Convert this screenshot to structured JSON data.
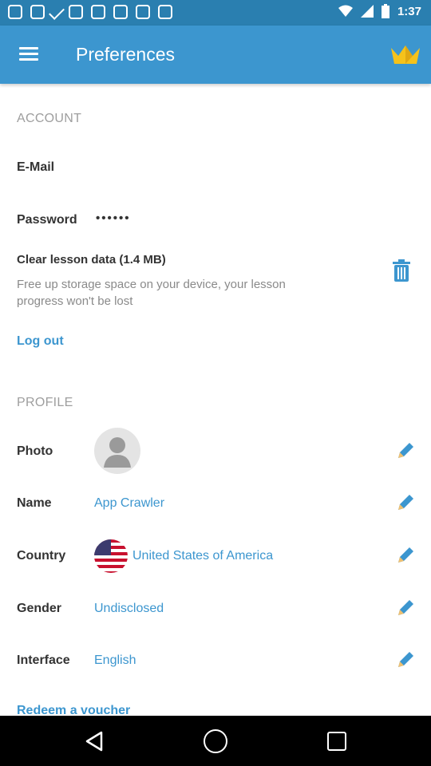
{
  "status_bar": {
    "time": "1:37"
  },
  "app_bar": {
    "title": "Preferences",
    "menu_icon": "menu-icon",
    "premium_icon": "crown-icon"
  },
  "account": {
    "header": "ACCOUNT",
    "email_label": "E-Mail",
    "password_label": "Password",
    "password_value": "••••••",
    "clear_title": "Clear lesson data (1.4 MB)",
    "clear_desc_line1": "Free up storage space on your device, your lesson",
    "clear_desc_line2": "progress won't be lost",
    "logout": "Log out"
  },
  "profile": {
    "header": "PROFILE",
    "photo_label": "Photo",
    "name_label": "Name",
    "name_value": "App Crawler",
    "country_label": "Country",
    "country_value": "United States of America",
    "gender_label": "Gender",
    "gender_value": "Undisclosed",
    "interface_label": "Interface",
    "interface_value": "English",
    "voucher": "Redeem a voucher"
  },
  "colors": {
    "accent": "#3c96cf",
    "status_bar": "#2a7fb0",
    "crown": "#f5c21b"
  }
}
